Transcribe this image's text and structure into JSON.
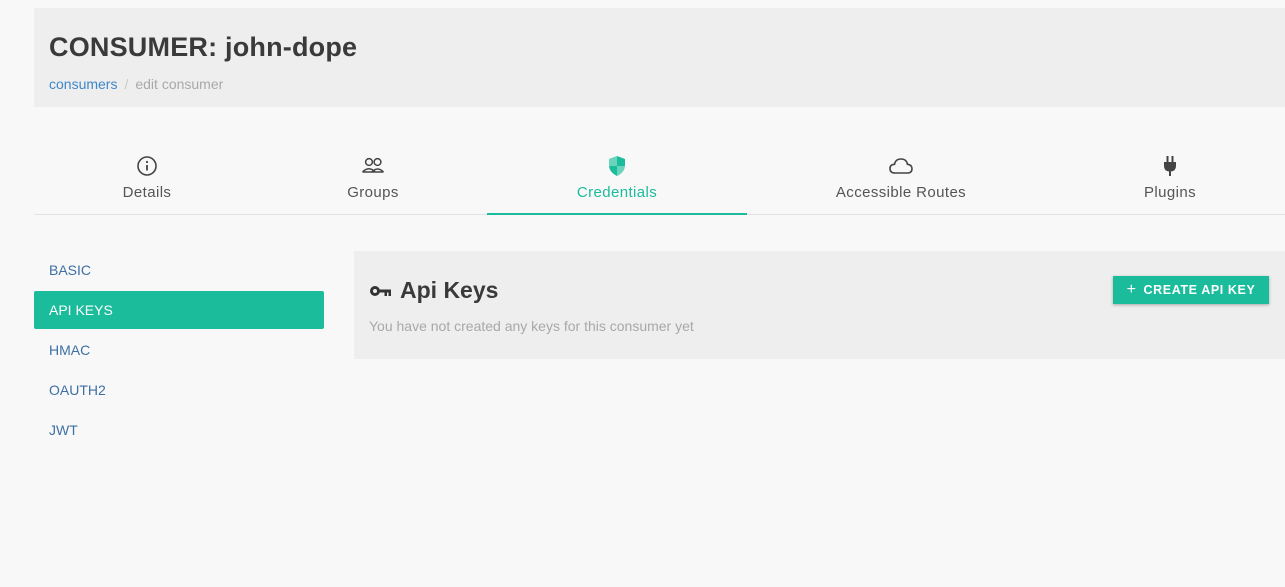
{
  "header": {
    "title": "CONSUMER: john-dope",
    "breadcrumb": {
      "link": "consumers",
      "separator": "/",
      "current": "edit consumer"
    }
  },
  "tabs": [
    {
      "label": "Details",
      "icon": "info-icon",
      "active": false
    },
    {
      "label": "Groups",
      "icon": "groups-icon",
      "active": false
    },
    {
      "label": "Credentials",
      "icon": "shield-icon",
      "active": true
    },
    {
      "label": "Accessible Routes",
      "icon": "cloud-icon",
      "active": false
    },
    {
      "label": "Plugins",
      "icon": "plug-icon",
      "active": false
    }
  ],
  "sidenav": {
    "items": [
      {
        "label": "BASIC",
        "active": false
      },
      {
        "label": "API KEYS",
        "active": true
      },
      {
        "label": "HMAC",
        "active": false
      },
      {
        "label": "OAUTH2",
        "active": false
      },
      {
        "label": "JWT",
        "active": false
      }
    ]
  },
  "panel": {
    "title": "Api Keys",
    "title_icon": "key-icon",
    "description": "You have not created any keys for this consumer yet",
    "create_button": "CREATE API KEY"
  },
  "colors": {
    "accent": "#1abc9c",
    "link": "#3e87c8",
    "header_bg": "#eeeeee",
    "page_bg": "#f8f8f8"
  }
}
